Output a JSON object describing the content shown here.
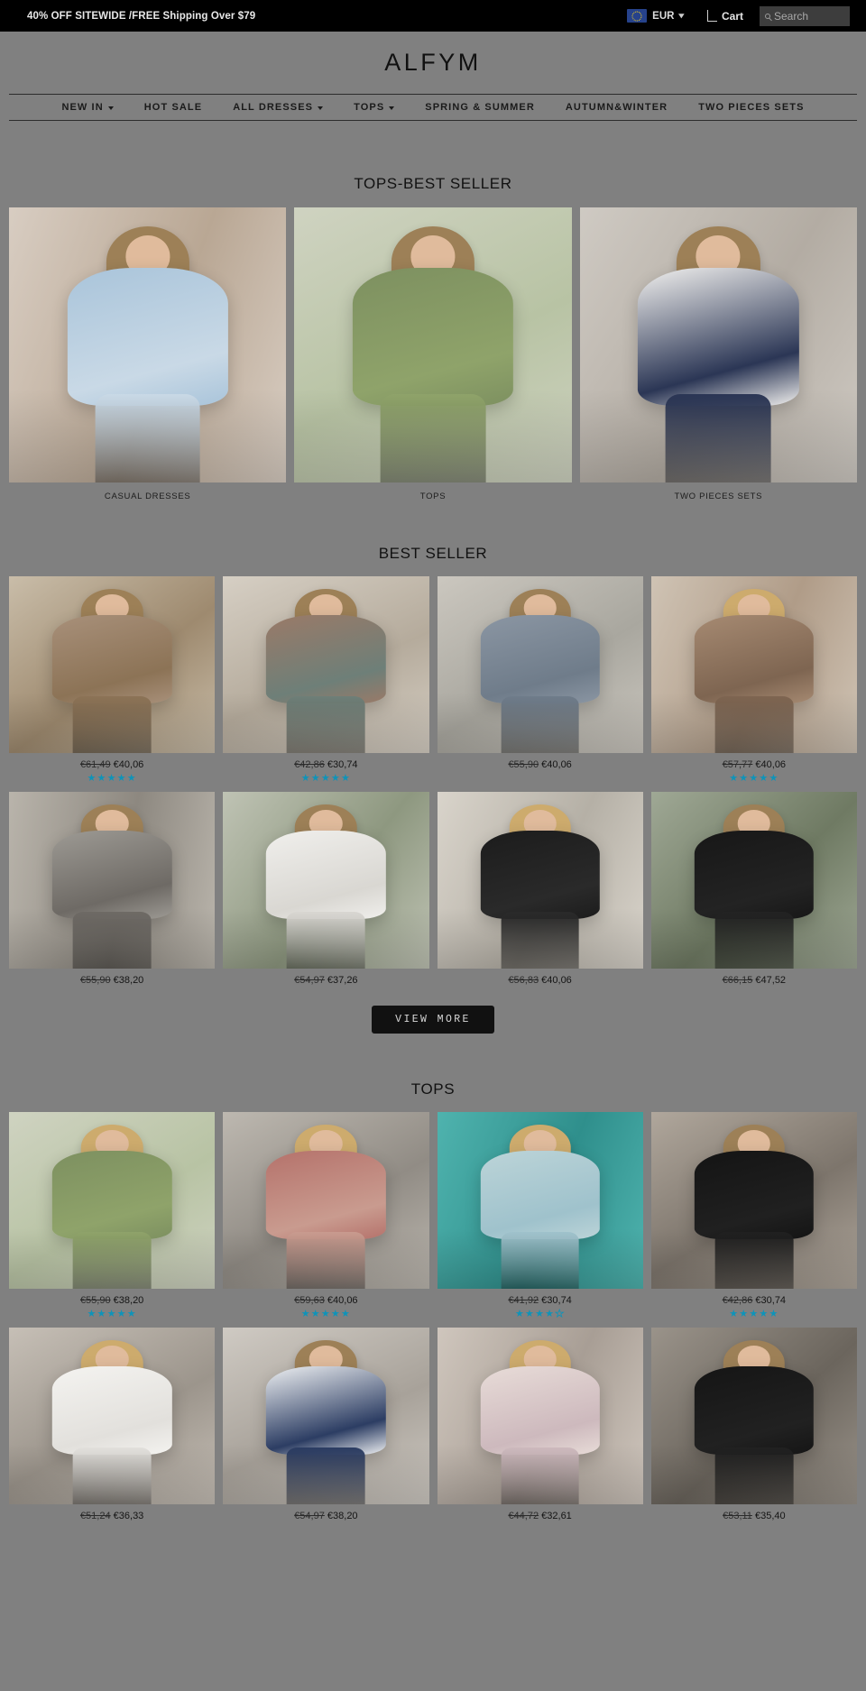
{
  "topbar": {
    "promo": "40% OFF SITEWIDE /FREE Shipping Over $79",
    "currency_label": "EUR",
    "currency_icon": "eu-flag-icon",
    "chevron_icon": "chevron-down-icon",
    "cart_label": "Cart",
    "cart_icon": "shopping-bag-icon",
    "search_icon": "search-icon",
    "search_placeholder": "Search",
    "search_value": ""
  },
  "header": {
    "logo": "ALFYM"
  },
  "nav": {
    "items": [
      {
        "label": "NEW IN",
        "has_caret": true
      },
      {
        "label": "HOT SALE",
        "has_caret": false
      },
      {
        "label": "ALL DRESSES",
        "has_caret": true
      },
      {
        "label": "TOPS",
        "has_caret": true
      },
      {
        "label": "SPRING & SUMMER",
        "has_caret": false
      },
      {
        "label": "AUTUMN&WINTER",
        "has_caret": false
      },
      {
        "label": "TWO PIECES SETS",
        "has_caret": false
      }
    ]
  },
  "sections": {
    "tops_best_seller": {
      "title": "TOPS-BEST SELLER",
      "categories": [
        {
          "label": "CASUAL DRESSES",
          "image": "woman-in-light-blue-tiered-ruffle-dress-indoors"
        },
        {
          "label": "TOPS",
          "image": "woman-in-green-floral-button-blouse-with-jeans"
        },
        {
          "label": "TWO PIECES SETS",
          "image": "woman-in-white-anchor-print-top-and-navy-pants"
        }
      ]
    },
    "best_seller": {
      "title": "BEST SELLER",
      "view_more_label": "VIEW MORE",
      "products": [
        {
          "image": "woman-in-paisley-print-maxi-dress-with-straw-bag",
          "price_old": "€61,49",
          "price_new": "€40,06",
          "stars_filled": 5,
          "stars_total": 5,
          "has_rating": true
        },
        {
          "image": "woman-in-red-and-teal-ornate-print-tee",
          "price_old": "€42,86",
          "price_new": "€30,74",
          "stars_filled": 5,
          "stars_total": 5,
          "has_rating": true
        },
        {
          "image": "woman-in-grey-blue-paisley-cowl-neck-button-top",
          "price_old": "€55,90",
          "price_new": "€40,06",
          "stars_filled": 0,
          "stars_total": 5,
          "has_rating": false
        },
        {
          "image": "woman-in-floral-v-neck-puff-sleeve-mini-dress",
          "price_old": "€57,77",
          "price_new": "€40,06",
          "stars_filled": 5,
          "stars_total": 5,
          "has_rating": true
        },
        {
          "image": "woman-in-grey-polka-dot-blouse-with-white-jeans",
          "price_old": "€55,90",
          "price_new": "€38,20",
          "stars_filled": 0,
          "stars_total": 5,
          "has_rating": false
        },
        {
          "image": "woman-in-white-v-neck-long-sleeve-blouse",
          "price_old": "€54,97",
          "price_new": "€37,26",
          "stars_filled": 0,
          "stars_total": 5,
          "has_rating": false
        },
        {
          "image": "woman-in-black-dress-with-patterned-hem-and-necklace",
          "price_old": "€56,83",
          "price_new": "€40,06",
          "stars_filled": 0,
          "stars_total": 5,
          "has_rating": false
        },
        {
          "image": "woman-in-black-v-neck-flowing-midi-dress-outdoors",
          "price_old": "€66,15",
          "price_new": "€47,52",
          "stars_filled": 0,
          "stars_total": 5,
          "has_rating": false
        }
      ]
    },
    "tops": {
      "title": "TOPS",
      "products": [
        {
          "image": "woman-in-green-floral-button-blouse",
          "price_old": "€55,90",
          "price_new": "€38,20",
          "stars_filled": 5,
          "stars_total": 5,
          "has_rating": true
        },
        {
          "image": "woman-in-red-plaid-flannel-shirt-with-white-tee",
          "price_old": "€59,63",
          "price_new": "€40,06",
          "stars_filled": 5,
          "stars_total": 5,
          "has_rating": true
        },
        {
          "image": "woman-in-pastel-tie-dye-v-neck-top-by-teal-shutters",
          "price_old": "€41,92",
          "price_new": "€30,74",
          "stars_filled": 4,
          "stars_total": 5,
          "has_rating": true
        },
        {
          "image": "woman-in-black-sleeveless-tank-top-with-jeans",
          "price_old": "€42,86",
          "price_new": "€30,74",
          "stars_filled": 5,
          "stars_total": 5,
          "has_rating": true
        },
        {
          "image": "woman-in-white-lace-sleeve-ruffle-blouse",
          "price_old": "€51,24",
          "price_new": "€36,33",
          "stars_filled": 0,
          "stars_total": 5,
          "has_rating": false
        },
        {
          "image": "woman-in-navy-striped-anchor-print-hoodie",
          "price_old": "€54,97",
          "price_new": "€38,20",
          "stars_filled": 0,
          "stars_total": 5,
          "has_rating": false
        },
        {
          "image": "woman-in-pastel-floral-patchwork-short-sleeve-top",
          "price_old": "€44,72",
          "price_new": "€32,61",
          "stars_filled": 0,
          "stars_total": 5,
          "has_rating": false
        },
        {
          "image": "woman-in-black-bow-print-long-sleeve-tee",
          "price_old": "€53,11",
          "price_new": "€35,40",
          "stars_filled": 0,
          "stars_total": 5,
          "has_rating": false
        }
      ]
    }
  },
  "colors": {
    "page_bg": "#808080",
    "topbar_bg": "#000000",
    "star": "#0f93b8",
    "button_bg": "#111111"
  }
}
